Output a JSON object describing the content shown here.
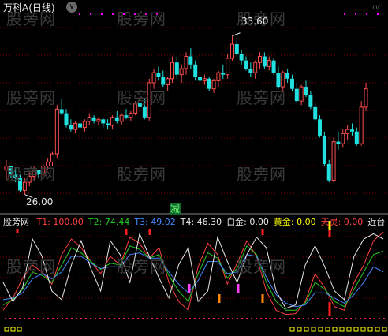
{
  "title": "万科A(日线)",
  "watermark": "股旁网",
  "price_labels": {
    "high": "33.60",
    "low": "26.00"
  },
  "signal_label": "减",
  "indicator": {
    "name": "股旁网",
    "fields": [
      {
        "label": "T1: 100.00",
        "color": "#ff4040"
      },
      {
        "label": "T2: 74.44",
        "color": "#22cc22"
      },
      {
        "label": "T3: 49.02",
        "color": "#4488ff"
      },
      {
        "label": "T4: 46.30",
        "color": "#e8e8e8"
      },
      {
        "label": "白金: 0.00",
        "color": "#e8e8e8"
      },
      {
        "label": "黄金: 0.00",
        "color": "#ffff00"
      },
      {
        "label": "天灵: 0.00",
        "color": "#ff4040"
      },
      {
        "label": "近台",
        "color": "#e8e8e8"
      }
    ]
  },
  "colors": {
    "up": "#ff4d4d",
    "down": "#20e0e0",
    "grid": "#8b0000",
    "dots": "#ff00ff"
  },
  "candles": [
    [
      27.0,
      27.5,
      26.5,
      27.2
    ],
    [
      27.2,
      27.2,
      26.6,
      26.8
    ],
    [
      26.8,
      27.1,
      26.4,
      26.6
    ],
    [
      26.6,
      26.8,
      25.9,
      26.0
    ],
    [
      26.0,
      26.6,
      25.8,
      26.4
    ],
    [
      26.4,
      26.9,
      26.2,
      26.7
    ],
    [
      26.7,
      27.2,
      26.5,
      27.0
    ],
    [
      27.0,
      27.0,
      26.6,
      26.8
    ],
    [
      26.8,
      27.3,
      26.7,
      27.2
    ],
    [
      27.2,
      27.6,
      27.0,
      27.4
    ],
    [
      27.4,
      27.9,
      27.2,
      27.8
    ],
    [
      27.8,
      30.2,
      27.6,
      30.0
    ],
    [
      30.0,
      30.5,
      29.7,
      29.8
    ],
    [
      29.8,
      30.0,
      29.1,
      29.2
    ],
    [
      29.2,
      29.5,
      28.9,
      29.0
    ],
    [
      29.0,
      29.4,
      28.8,
      29.3
    ],
    [
      29.3,
      29.6,
      29.0,
      29.1
    ],
    [
      29.1,
      29.5,
      28.9,
      29.4
    ],
    [
      29.4,
      29.8,
      29.2,
      29.6
    ],
    [
      29.6,
      29.7,
      29.3,
      29.4
    ],
    [
      29.4,
      29.6,
      29.2,
      29.5
    ],
    [
      29.5,
      29.6,
      29.1,
      29.3
    ],
    [
      29.3,
      29.5,
      29.0,
      29.2
    ],
    [
      29.2,
      29.7,
      29.0,
      29.6
    ],
    [
      29.6,
      29.9,
      29.3,
      29.4
    ],
    [
      29.4,
      29.8,
      29.2,
      29.7
    ],
    [
      29.7,
      30.0,
      29.5,
      29.6
    ],
    [
      29.6,
      29.9,
      29.4,
      29.8
    ],
    [
      29.8,
      30.4,
      29.7,
      30.3
    ],
    [
      30.3,
      30.6,
      30.0,
      30.1
    ],
    [
      30.1,
      30.5,
      29.5,
      29.6
    ],
    [
      29.6,
      31.5,
      29.4,
      31.3
    ],
    [
      31.3,
      32.0,
      31.0,
      31.8
    ],
    [
      31.8,
      32.1,
      31.4,
      31.6
    ],
    [
      31.6,
      31.9,
      31.1,
      31.2
    ],
    [
      31.2,
      31.6,
      30.9,
      31.5
    ],
    [
      31.5,
      32.6,
      31.3,
      32.3
    ],
    [
      32.3,
      32.6,
      31.5,
      31.7
    ],
    [
      31.7,
      32.2,
      31.3,
      32.0
    ],
    [
      32.0,
      32.8,
      31.7,
      32.6
    ],
    [
      32.6,
      33.0,
      32.0,
      32.2
    ],
    [
      32.2,
      32.4,
      31.4,
      31.6
    ],
    [
      31.6,
      32.0,
      31.2,
      31.4
    ],
    [
      31.4,
      31.7,
      31.2,
      31.5
    ],
    [
      31.5,
      31.6,
      30.9,
      31.0
    ],
    [
      31.0,
      31.5,
      30.8,
      31.4
    ],
    [
      31.4,
      31.9,
      31.1,
      31.8
    ],
    [
      31.8,
      32.2,
      31.5,
      31.7
    ],
    [
      31.7,
      32.7,
      31.5,
      32.5
    ],
    [
      32.5,
      33.6,
      32.4,
      33.2
    ],
    [
      33.2,
      33.4,
      32.6,
      32.7
    ],
    [
      32.7,
      32.9,
      32.2,
      32.4
    ],
    [
      32.4,
      32.6,
      31.9,
      32.0
    ],
    [
      32.0,
      32.3,
      31.6,
      31.8
    ],
    [
      31.8,
      32.4,
      31.5,
      32.3
    ],
    [
      32.3,
      32.8,
      32.0,
      32.6
    ],
    [
      32.6,
      32.8,
      32.0,
      32.1
    ],
    [
      32.1,
      32.6,
      31.9,
      32.4
    ],
    [
      32.4,
      32.5,
      31.7,
      31.8
    ],
    [
      31.8,
      32.1,
      31.0,
      31.1
    ],
    [
      31.1,
      31.9,
      30.9,
      31.8
    ],
    [
      31.8,
      32.0,
      31.3,
      31.5
    ],
    [
      31.5,
      31.7,
      30.9,
      31.0
    ],
    [
      31.0,
      31.3,
      30.3,
      30.4
    ],
    [
      30.4,
      31.2,
      30.2,
      31.1
    ],
    [
      31.1,
      31.4,
      30.6,
      30.7
    ],
    [
      30.7,
      30.9,
      30.0,
      30.1
    ],
    [
      30.1,
      30.3,
      29.4,
      29.5
    ],
    [
      29.5,
      29.7,
      28.6,
      28.7
    ],
    [
      28.7,
      28.9,
      27.2,
      27.3
    ],
    [
      27.3,
      27.5,
      26.4,
      26.5
    ],
    [
      26.5,
      28.6,
      26.4,
      28.4
    ],
    [
      28.4,
      28.9,
      28.0,
      28.3
    ],
    [
      28.3,
      29.0,
      28.1,
      28.8
    ],
    [
      28.8,
      29.2,
      28.5,
      29.0
    ],
    [
      29.0,
      29.3,
      28.7,
      28.9
    ],
    [
      28.9,
      29.1,
      28.2,
      28.3
    ],
    [
      28.3,
      30.4,
      28.2,
      30.1
    ],
    [
      30.1,
      31.3,
      29.9,
      31.0
    ]
  ],
  "ind_series": [
    {
      "name": "T1",
      "color": "#ff4040",
      "values": [
        8,
        22,
        45,
        60,
        52,
        38,
        72,
        90,
        80,
        64,
        50,
        70,
        60,
        92,
        85,
        68,
        80,
        40,
        18,
        8,
        58,
        85,
        72,
        38,
        62,
        88,
        70,
        30,
        8,
        3,
        4,
        18,
        50,
        34,
        12,
        8,
        40,
        60,
        88,
        98
      ]
    },
    {
      "name": "T2",
      "color": "#22cc22",
      "values": [
        14,
        20,
        32,
        52,
        48,
        40,
        60,
        80,
        74,
        64,
        55,
        62,
        60,
        82,
        78,
        68,
        72,
        48,
        30,
        18,
        50,
        74,
        68,
        45,
        56,
        82,
        72,
        40,
        18,
        8,
        8,
        16,
        40,
        32,
        18,
        12,
        32,
        52,
        72,
        76
      ]
    },
    {
      "name": "T3",
      "color": "#4488ff",
      "values": [
        20,
        22,
        28,
        44,
        50,
        44,
        52,
        70,
        70,
        62,
        56,
        58,
        58,
        72,
        74,
        68,
        68,
        52,
        38,
        28,
        42,
        64,
        64,
        50,
        52,
        72,
        70,
        46,
        26,
        16,
        12,
        14,
        28,
        28,
        22,
        16,
        26,
        40,
        58,
        52
      ]
    },
    {
      "name": "T4",
      "color": "#e8e8e8",
      "values": [
        40,
        18,
        34,
        90,
        70,
        30,
        20,
        60,
        88,
        56,
        30,
        88,
        72,
        40,
        96,
        70,
        45,
        22,
        60,
        80,
        18,
        30,
        92,
        64,
        40,
        72,
        92,
        80,
        30,
        10,
        14,
        60,
        82,
        58,
        30,
        20,
        70,
        90,
        96,
        90
      ]
    }
  ],
  "ind_markers": [
    {
      "i": 3,
      "color": "#ff2020"
    },
    {
      "i": 36,
      "color": "#ffff00"
    },
    {
      "i": 36,
      "color": "#ff2020"
    }
  ]
}
